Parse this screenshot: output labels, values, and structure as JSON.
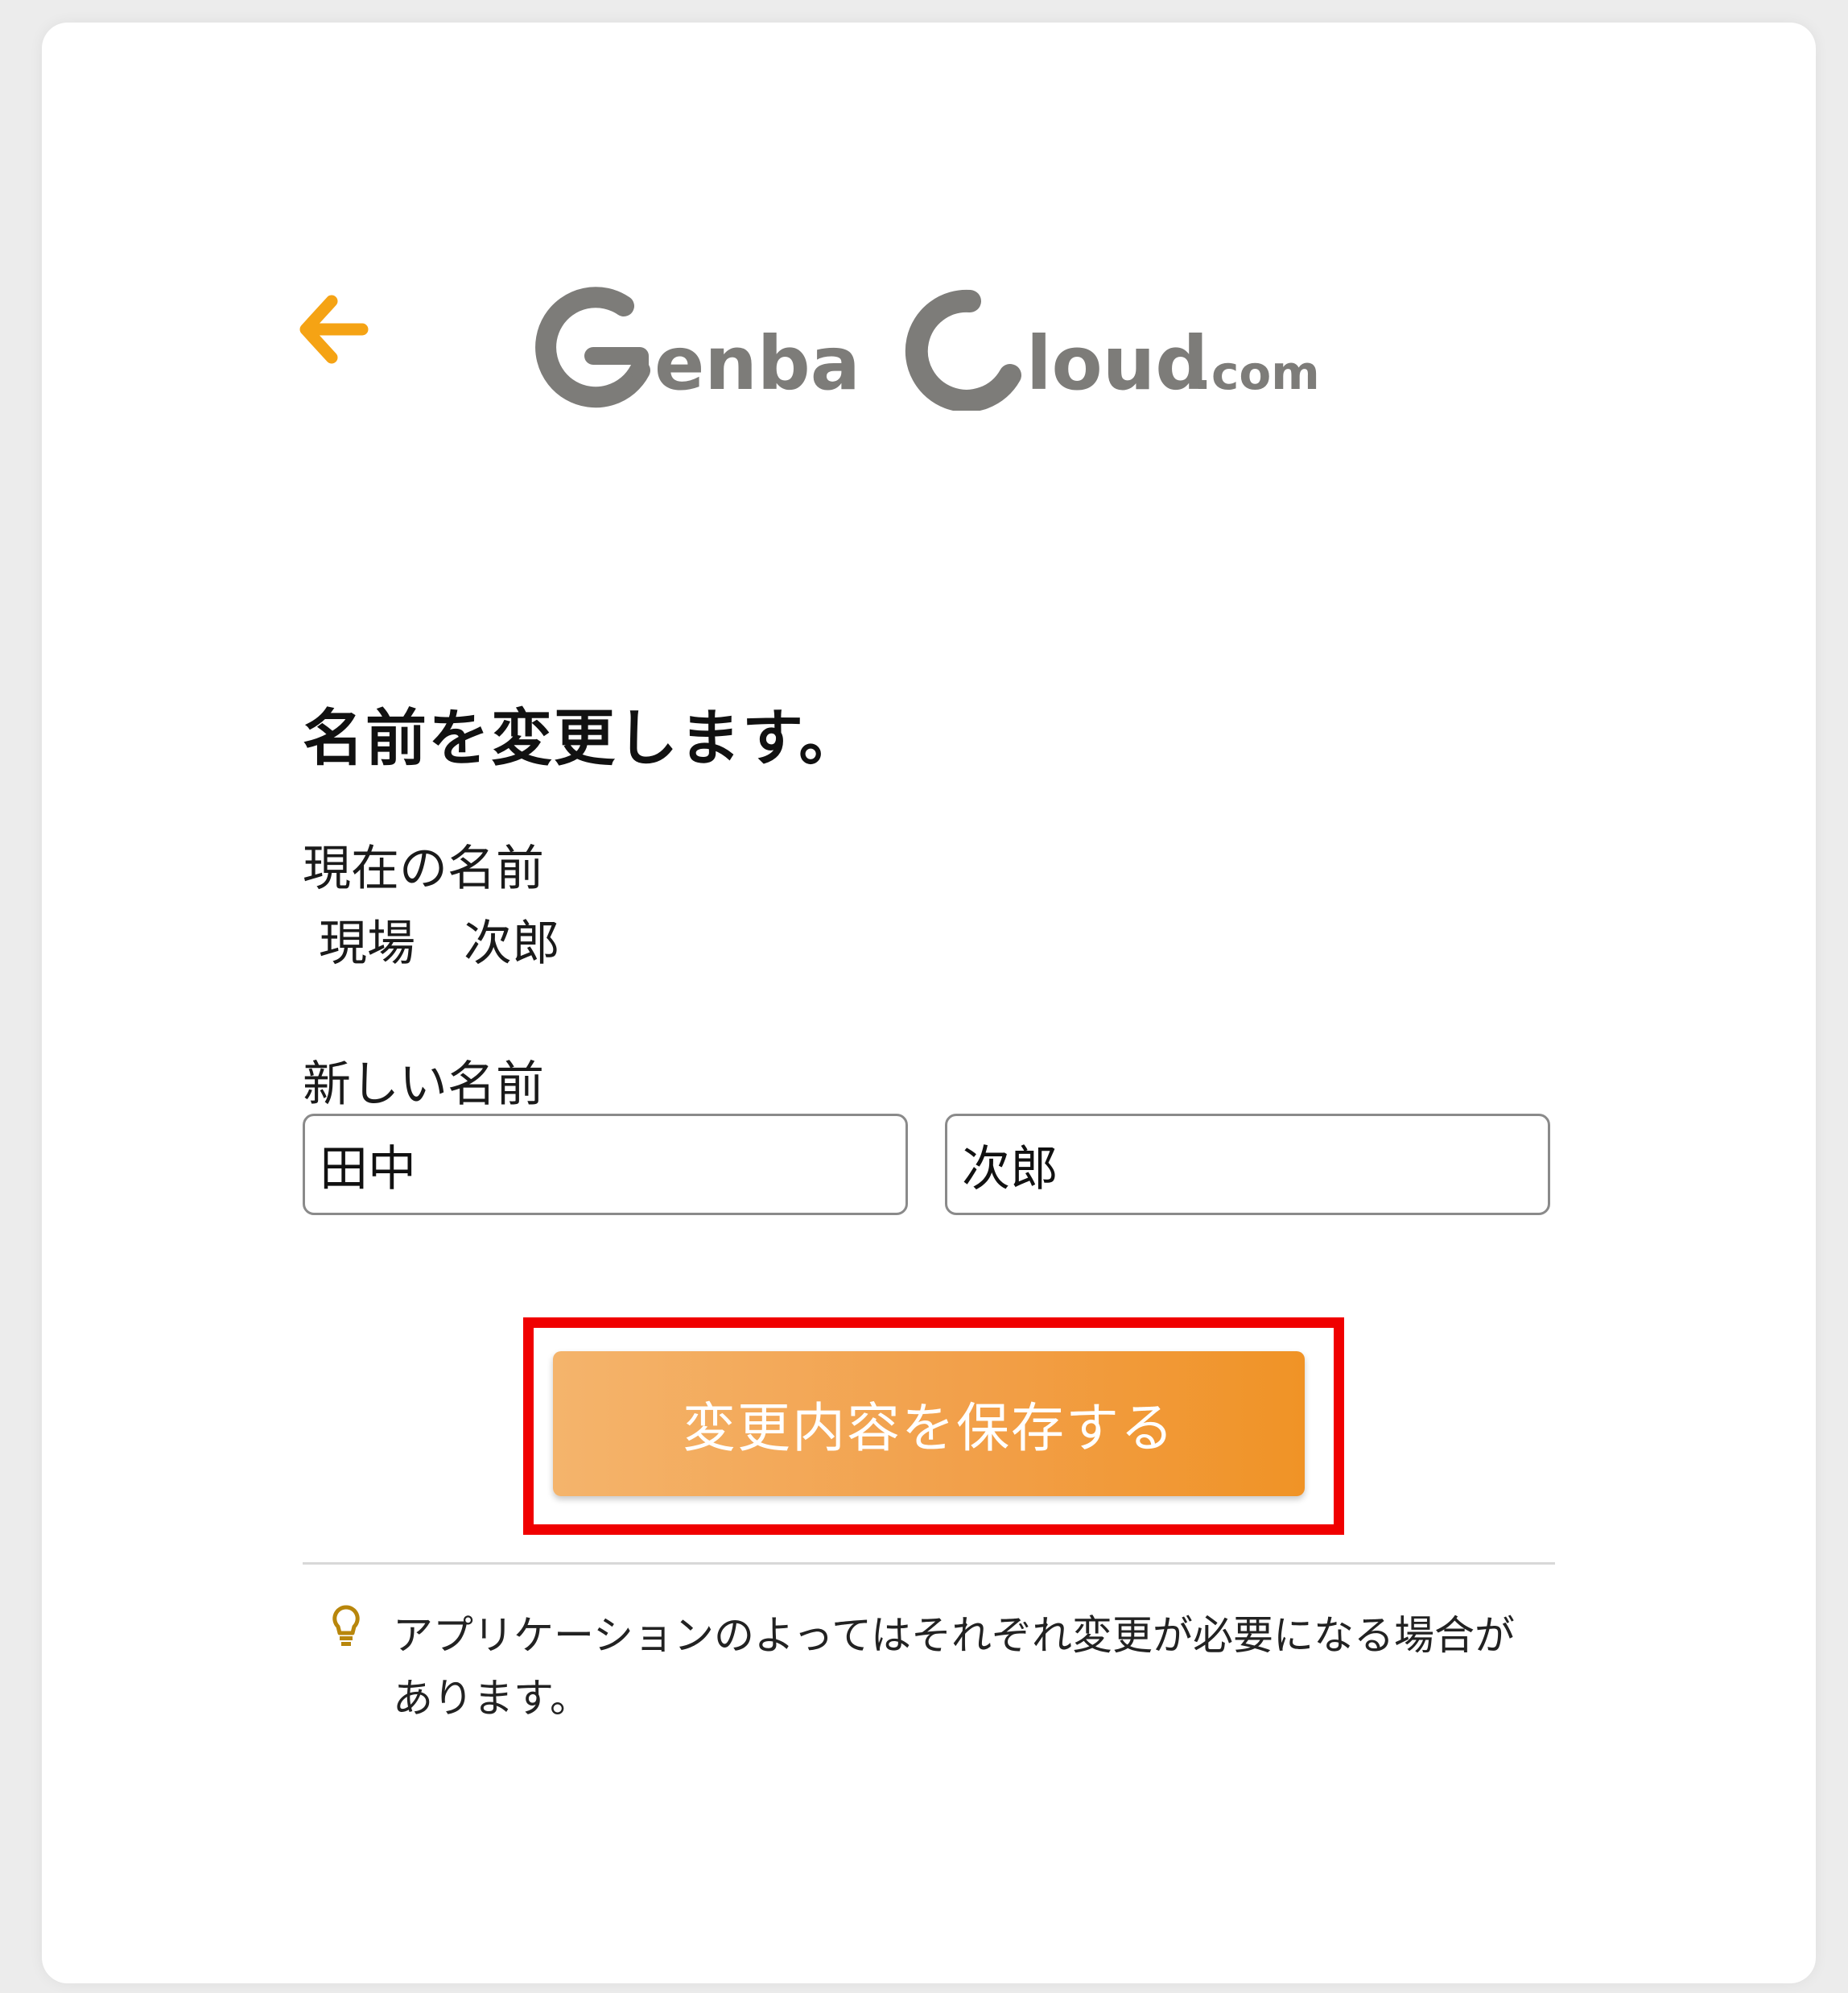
{
  "header": {
    "back_icon": "arrow-left-icon",
    "logo": {
      "text_genba": "Genba",
      "text_cloud": "Cloud",
      "text_com": ".com",
      "color": "#7d7c79"
    }
  },
  "form": {
    "title": "名前を変更します。",
    "current_name_label": "現在の名前",
    "current_name_value": "現場　次郎",
    "new_name_label": "新しい名前",
    "last_name_value": "田中",
    "first_name_value": "次郎",
    "save_label": "変更内容を保存する"
  },
  "hint": {
    "icon": "lightbulb-icon",
    "text": "アプリケーションのよってはそれぞれ変更が必要になる場合があります。"
  },
  "colors": {
    "accent": "#f39c12",
    "button_gradient_start": "#f4b46c",
    "button_gradient_end": "#f09326",
    "highlight_border": "#f00000"
  }
}
